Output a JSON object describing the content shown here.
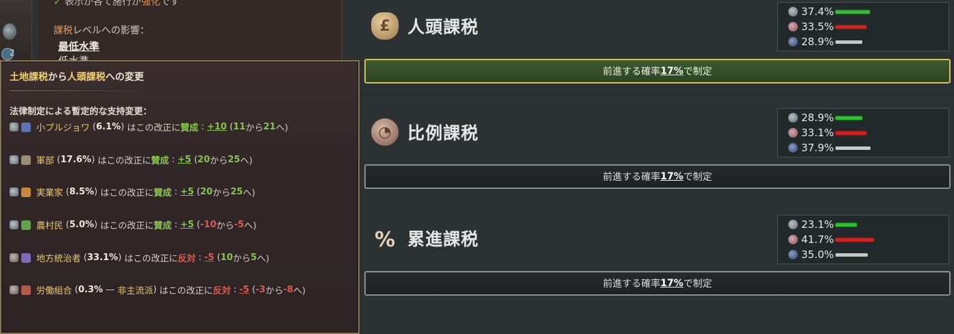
{
  "background_panel": {
    "left_strip_count": "2",
    "line1": {
      "mark": "✓",
      "text": "表示が各て施行が",
      "highlight": "強化",
      "tail": "です"
    },
    "tax_level_label": {
      "highlight": "課税",
      "rest": "レベルへの影響："
    },
    "tax_level_value": "最低水準",
    "tax_level_next": "低水準"
  },
  "tooltip": {
    "title": {
      "part1": "土地課税",
      "part2": "から",
      "part3": "人頭課税",
      "part4": "への変更"
    },
    "subtitle": "法律制定による暫定的な支持変更：",
    "rows": [
      {
        "name": "小プルジョワ",
        "share": "6.1%",
        "mid": "はこの改正に",
        "stance": "賛成",
        "delta": "+10",
        "from": "11",
        "kara": "から",
        "to": "21",
        "he": "へ)",
        "stance_type": "support"
      },
      {
        "name": "軍部",
        "share": "17.6%",
        "mid": "はこの改正に",
        "stance": "賛成",
        "delta": "+5",
        "from": "20",
        "kara": "から",
        "to": "25",
        "he": "へ)",
        "stance_type": "support"
      },
      {
        "name": "実業家",
        "share": "8.5%",
        "mid": "はこの改正に",
        "stance": "賛成",
        "delta": "+5",
        "from": "20",
        "kara": "から",
        "to": "25",
        "he": "へ)",
        "stance_type": "support"
      },
      {
        "name": "農村民",
        "share": "5.0%",
        "mid": "はこの改正に",
        "stance": "賛成",
        "delta": "+5",
        "from": "-10",
        "kara": "から",
        "to": "-5",
        "he": "へ)",
        "stance_type": "support"
      },
      {
        "name": "地方統治者",
        "share": "33.1%",
        "mid": "はこの改正に",
        "stance": "反対",
        "delta": "-5",
        "from": "10",
        "kara": "から",
        "to": "5",
        "he": "へ)",
        "stance_type": "oppose"
      },
      {
        "name": "労働組合",
        "share": "0.3%",
        "nonmain": "非主流派",
        "mid": "はこの改正に",
        "stance": "反対",
        "delta": "-5",
        "from": "-3",
        "kara": "から",
        "to": "-8",
        "he": "へ)",
        "stance_type": "oppose"
      }
    ]
  },
  "laws": [
    {
      "name": "人頭課税",
      "icon": "money-bag",
      "icon_glyph": "£",
      "support": "37.4%",
      "oppose": "33.5%",
      "neutral": "28.9%",
      "support_v": 37.4,
      "oppose_v": 33.5,
      "neutral_v": 28.9,
      "enact_prefix": "前進する確率",
      "enact_rate": "17%",
      "enact_suffix": "で制定"
    },
    {
      "name": "比例課税",
      "icon": "pie-chart",
      "icon_glyph": "◔",
      "support": "28.9%",
      "oppose": "33.1%",
      "neutral": "37.9%",
      "support_v": 28.9,
      "oppose_v": 33.1,
      "neutral_v": 37.9,
      "enact_prefix": "前進する確率",
      "enact_rate": "17%",
      "enact_suffix": "で制定"
    },
    {
      "name": "累進課税",
      "icon": "percent",
      "icon_glyph": "%",
      "support": "23.1%",
      "oppose": "41.7%",
      "neutral": "35.0%",
      "support_v": 23.1,
      "oppose_v": 41.7,
      "neutral_v": 35.0,
      "enact_prefix": "前進する確率",
      "enact_rate": "17%",
      "enact_suffix": "で制定"
    }
  ],
  "colors": {
    "support": "#2fbf2f",
    "oppose": "#d02020",
    "neutral": "#c8c8c8",
    "tooltip_border": "#8a7652",
    "highlight_border": "#d4c25a"
  }
}
